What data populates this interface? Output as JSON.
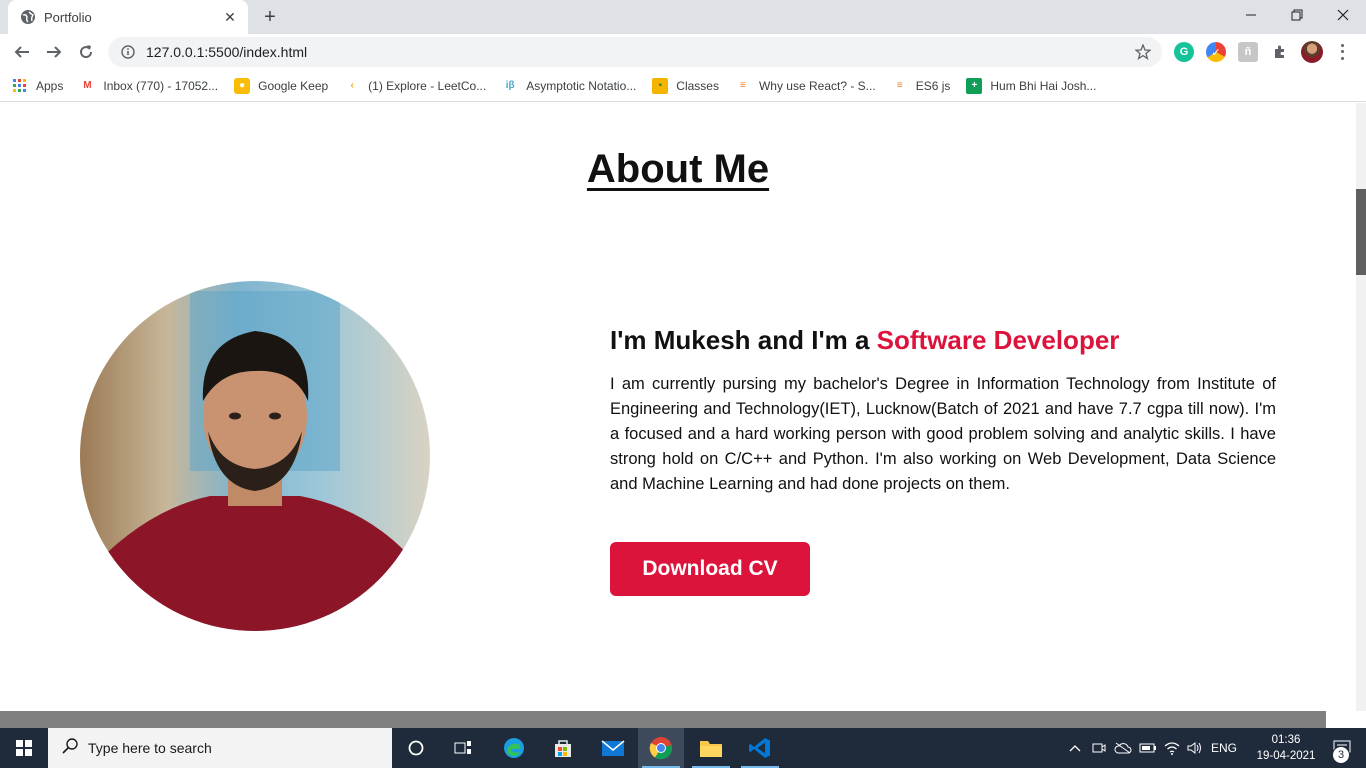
{
  "browser": {
    "tab_title": "Portfolio",
    "url": "127.0.0.1:5500/index.html",
    "bookmarks": [
      {
        "label": "Apps",
        "icon": "apps-grid-icon"
      },
      {
        "label": "Inbox (770) - 17052...",
        "icon": "gmail-icon"
      },
      {
        "label": "Google Keep",
        "icon": "keep-icon"
      },
      {
        "label": "(1) Explore - LeetCo...",
        "icon": "leetcode-icon"
      },
      {
        "label": "Asymptotic Notatio...",
        "icon": "interviewbit-icon"
      },
      {
        "label": "Classes",
        "icon": "classroom-icon"
      },
      {
        "label": "Why use React? - S...",
        "icon": "stackoverflow-icon"
      },
      {
        "label": "ES6 js",
        "icon": "stackoverflow-icon"
      },
      {
        "label": "Hum Bhi Hai Josh...",
        "icon": "sheets-icon"
      }
    ]
  },
  "page": {
    "title": "About Me",
    "intro_prefix": "I'm Mukesh and I'm a ",
    "intro_accent": "Software Developer",
    "bio": "I am currently pursing my bachelor's Degree in Information Technology from Institute of Engineering and Technology(IET), Lucknow(Batch of 2021 and have 7.7 cgpa till now). I'm a focused and a hard working person with good problem solving and analytic skills. I have strong hold on C/C++ and Python. I'm also working on Web Development, Data Science and Machine Learning and had done projects on them.",
    "cv_button": "Download CV",
    "accent_color": "#dc143c"
  },
  "taskbar": {
    "search_placeholder": "Type here to search",
    "language": "ENG",
    "time": "01:36",
    "date": "19-04-2021",
    "notifications": "3"
  }
}
